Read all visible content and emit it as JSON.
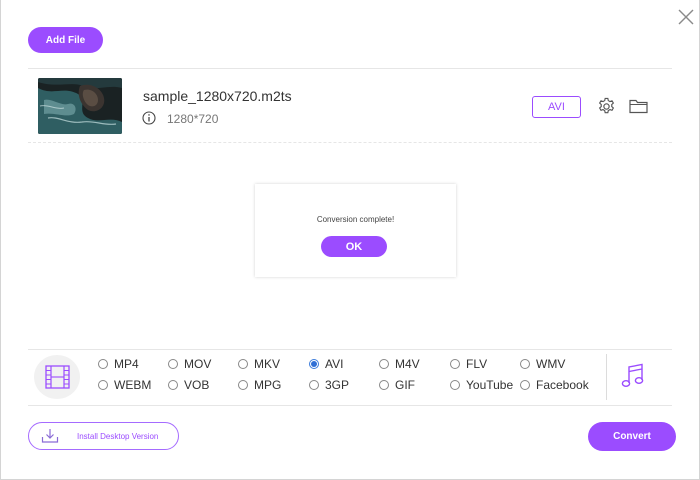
{
  "toolbar": {
    "add_file_label": "Add File"
  },
  "file": {
    "name": "sample_1280x720.m2ts",
    "resolution": "1280*720",
    "output_format": "AVI"
  },
  "dialog": {
    "message": "Conversion complete!",
    "ok_label": "OK"
  },
  "formats": {
    "selected": "AVI",
    "options": [
      "MP4",
      "MOV",
      "MKV",
      "AVI",
      "M4V",
      "FLV",
      "WMV",
      "WEBM",
      "VOB",
      "MPG",
      "3GP",
      "GIF",
      "YouTube",
      "Facebook"
    ]
  },
  "footer": {
    "install_label": "Install Desktop Version",
    "convert_label": "Convert"
  },
  "colors": {
    "accent": "#9b4cff",
    "radio_selected": "#2f6fd5"
  },
  "icons": {
    "close": "close-icon",
    "info": "info-icon",
    "settings": "gear-icon",
    "folder": "folder-icon",
    "video": "film-icon",
    "audio": "music-note-icon",
    "download": "download-icon"
  }
}
